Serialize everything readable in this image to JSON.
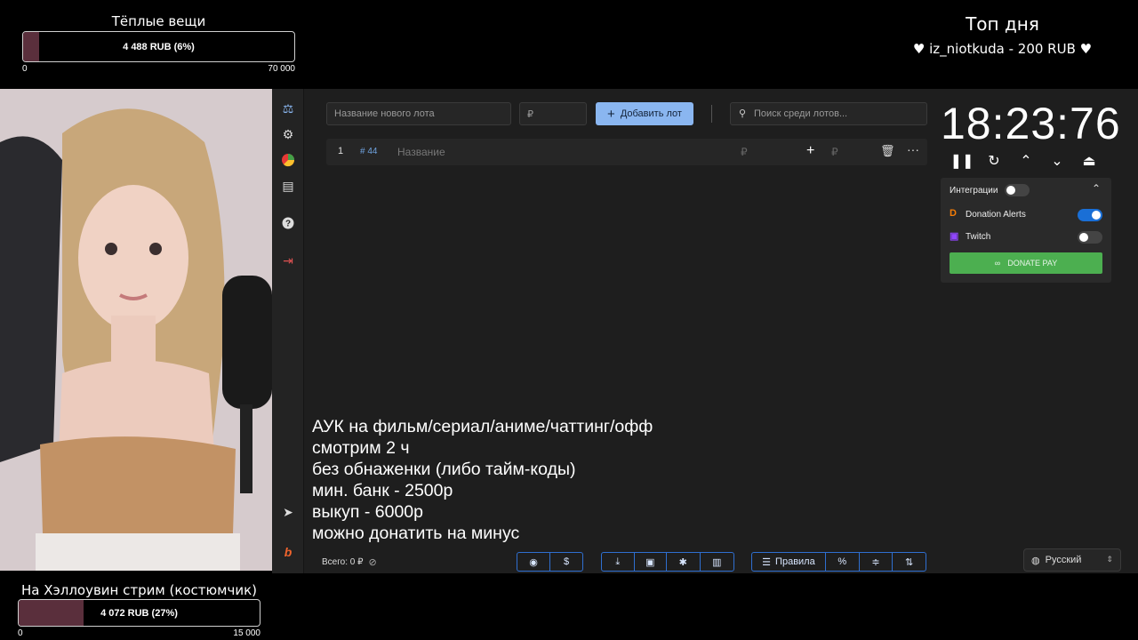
{
  "goal_top": {
    "title": "Тёплые вещи",
    "label": "4 488 RUB (6%)",
    "progress": 0.06,
    "min": "0",
    "max": "70 000"
  },
  "goal_bottom": {
    "title": "На Хэллоувин стрим (костюмчик)",
    "label": "4 072 RUB (27%)",
    "progress": 0.27,
    "min": "0",
    "max": "15 000"
  },
  "top_day": {
    "title": "Топ дня",
    "line": "♥ iz_niotkuda - 200 RUB ♥"
  },
  "toolbar": {
    "new_lot_placeholder": "Название нового лота",
    "amount_placeholder": "₽",
    "add_lot_label": "Добавить лот",
    "search_placeholder": "Поиск среди лотов..."
  },
  "lot_row": {
    "index": "1",
    "id": "# 44",
    "name_placeholder": "Название",
    "currency": "₽",
    "currency2": "₽"
  },
  "stream_text": "АУК на фильм/сериал/аниме/чаттинг/офф\nсмотрим 2 ч\nбез обнаженки (либо тайм-коды)\nмин. банк - 2500р\nвыкуп - 6000р\nможно донатить на минус",
  "footer": {
    "total_label": "Всего: 0 ₽",
    "rules_label": "Правила",
    "language": "Русский"
  },
  "timer": {
    "value": "18:23:76"
  },
  "integrations": {
    "title": "Интеграции",
    "items": [
      {
        "name": "Donation Alerts",
        "enabled": true
      },
      {
        "name": "Twitch",
        "enabled": false
      }
    ],
    "donate_pay_label": "DONATE PAY"
  },
  "colors": {
    "accent": "#8ab6f0",
    "toggle_on": "#1a6fd6",
    "donate_green": "#4caf50",
    "goal_fill": "#5a2f3c"
  }
}
